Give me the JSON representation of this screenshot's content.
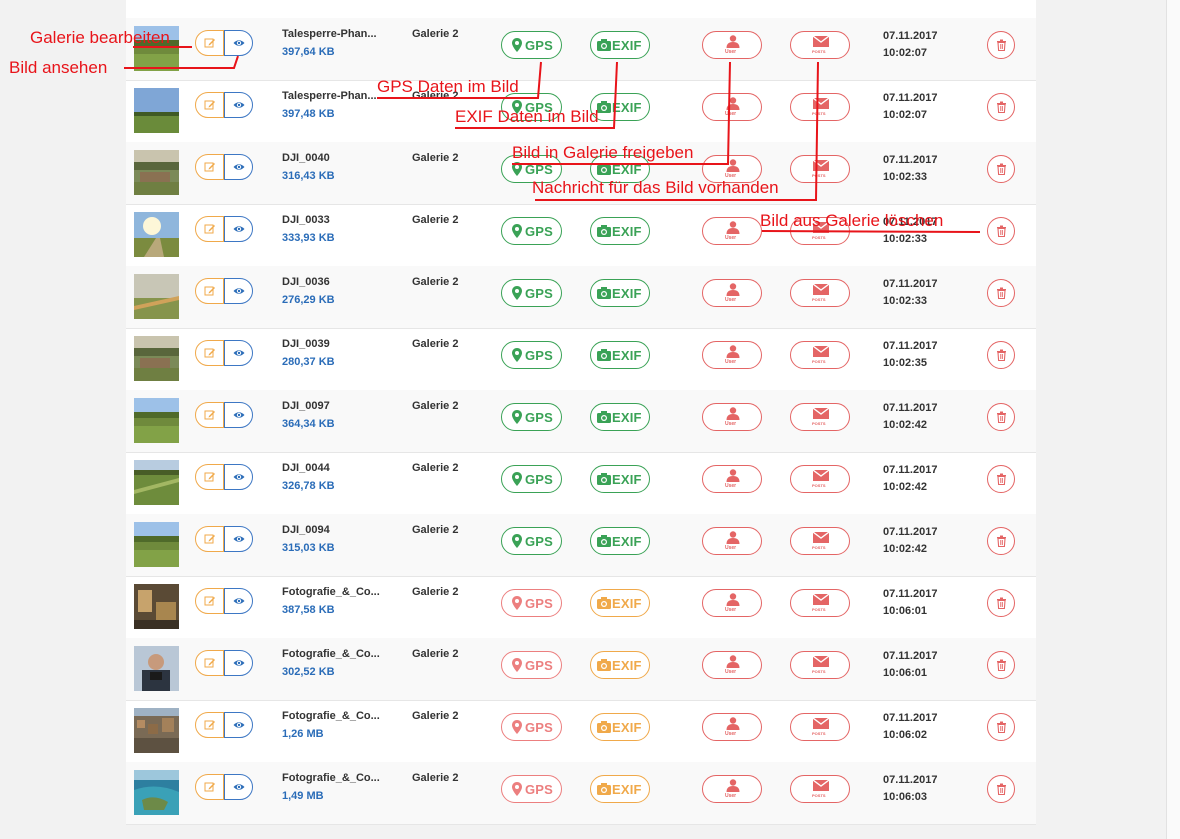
{
  "rows": [
    {
      "name": "Talesperre-Phan...",
      "size": "397,64 KB",
      "gallery": "Galerie 2",
      "gps_label": "GPS",
      "exif_label": "EXIF",
      "has_gps": true,
      "has_exif": true,
      "date": "07.11.2017",
      "time": "10:02:07",
      "thumb": "meadow"
    },
    {
      "name": "Talesperre-Phan...",
      "size": "397,48 KB",
      "gallery": "Galerie 2",
      "gps_label": "GPS",
      "exif_label": "EXIF",
      "has_gps": true,
      "has_exif": true,
      "date": "07.11.2017",
      "time": "10:02:07",
      "thumb": "sky"
    },
    {
      "name": "DJI_0040",
      "size": "316,43 KB",
      "gallery": "Galerie 2",
      "gps_label": "GPS",
      "exif_label": "EXIF",
      "has_gps": true,
      "has_exif": true,
      "date": "07.11.2017",
      "time": "10:02:33",
      "thumb": "village"
    },
    {
      "name": "DJI_0033",
      "size": "333,93 KB",
      "gallery": "Galerie 2",
      "gps_label": "GPS",
      "exif_label": "EXIF",
      "has_gps": true,
      "has_exif": true,
      "date": "07.11.2017",
      "time": "10:02:33",
      "thumb": "sunny"
    },
    {
      "name": "DJI_0036",
      "size": "276,29 KB",
      "gallery": "Galerie 2",
      "gps_label": "GPS",
      "exif_label": "EXIF",
      "has_gps": true,
      "has_exif": true,
      "date": "07.11.2017",
      "time": "10:02:33",
      "thumb": "haze"
    },
    {
      "name": "DJI_0039",
      "size": "280,37 KB",
      "gallery": "Galerie 2",
      "gps_label": "GPS",
      "exif_label": "EXIF",
      "has_gps": true,
      "has_exif": true,
      "date": "07.11.2017",
      "time": "10:02:35",
      "thumb": "village"
    },
    {
      "name": "DJI_0097",
      "size": "364,34 KB",
      "gallery": "Galerie 2",
      "gps_label": "GPS",
      "exif_label": "EXIF",
      "has_gps": true,
      "has_exif": true,
      "date": "07.11.2017",
      "time": "10:02:42",
      "thumb": "meadow"
    },
    {
      "name": "DJI_0044",
      "size": "326,78 KB",
      "gallery": "Galerie 2",
      "gps_label": "GPS",
      "exif_label": "EXIF",
      "has_gps": true,
      "has_exif": true,
      "date": "07.11.2017",
      "time": "10:02:42",
      "thumb": "field"
    },
    {
      "name": "DJI_0094",
      "size": "315,03 KB",
      "gallery": "Galerie 2",
      "gps_label": "GPS",
      "exif_label": "EXIF",
      "has_gps": true,
      "has_exif": true,
      "date": "07.11.2017",
      "time": "10:02:42",
      "thumb": "meadow"
    },
    {
      "name": "Fotografie_&_Co...",
      "size": "387,58 KB",
      "gallery": "Galerie 2",
      "gps_label": "GPS",
      "exif_label": "EXIF",
      "has_gps": false,
      "has_exif": false,
      "date": "07.11.2017",
      "time": "10:06:01",
      "thumb": "studio"
    },
    {
      "name": "Fotografie_&_Co...",
      "size": "302,52 KB",
      "gallery": "Galerie 2",
      "gps_label": "GPS",
      "exif_label": "EXIF",
      "has_gps": false,
      "has_exif": false,
      "date": "07.11.2017",
      "time": "10:06:01",
      "thumb": "portrait"
    },
    {
      "name": "Fotografie_&_Co...",
      "size": "1,26 MB",
      "gallery": "Galerie 2",
      "gps_label": "GPS",
      "exif_label": "EXIF",
      "has_gps": false,
      "has_exif": false,
      "date": "07.11.2017",
      "time": "10:06:02",
      "thumb": "city"
    },
    {
      "name": "Fotografie_&_Co...",
      "size": "1,49 MB",
      "gallery": "Galerie 2",
      "gps_label": "GPS",
      "exif_label": "EXIF",
      "has_gps": false,
      "has_exif": false,
      "date": "07.11.2017",
      "time": "10:06:03",
      "thumb": "coast"
    }
  ],
  "labels": {
    "user_small": "User",
    "posts_small": "POSTS"
  },
  "annotations": {
    "edit_gallery": "Galerie bearbeiten",
    "view_image": "Bild ansehen",
    "gps_data": "GPS Daten im Bild",
    "exif_data": "EXIF Daten im Bild",
    "share": "Bild in Galerie freigeben",
    "message": "Nachricht für das Bild vorhanden",
    "delete": "Bild aus Galerie löschen"
  },
  "colors": {
    "green": "#3aa256",
    "red": "#e46565",
    "orange": "#f0a94a",
    "blue": "#2a6cb8",
    "annotation": "#e8141a"
  }
}
